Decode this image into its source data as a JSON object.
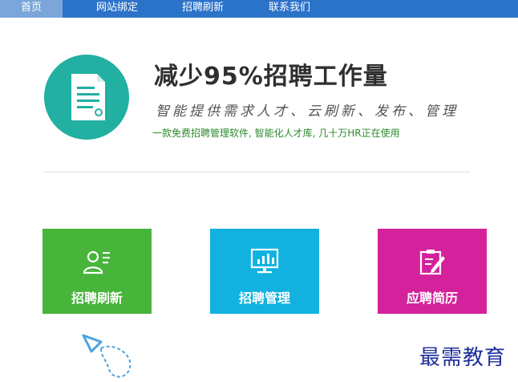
{
  "nav": {
    "tabs": [
      {
        "label": "首页",
        "active": true
      },
      {
        "label": "网站绑定",
        "active": false
      },
      {
        "label": "招聘刷新",
        "active": false
      },
      {
        "label": "联系我们",
        "active": false
      }
    ]
  },
  "hero": {
    "icon": "document-icon",
    "title": "减少95%招聘工作量",
    "subtitle": "智能提供需求人才、云刷新、发布、管理",
    "tagline": "一款免费招聘管理软件, 智能化人才库, 几十万HR正在使用"
  },
  "cards": [
    {
      "label": "招聘刷新",
      "icon": "user-list-icon",
      "color": "#47b43a"
    },
    {
      "label": "招聘管理",
      "icon": "monitor-chart-icon",
      "color": "#12b2e0"
    },
    {
      "label": "应聘简历",
      "icon": "resume-edit-icon",
      "color": "#d4229c"
    }
  ],
  "colors": {
    "nav": "#2b72c9",
    "nav_active": "#7aa6da",
    "hero_circle": "#21b0a2"
  },
  "watermark": "最需教育"
}
